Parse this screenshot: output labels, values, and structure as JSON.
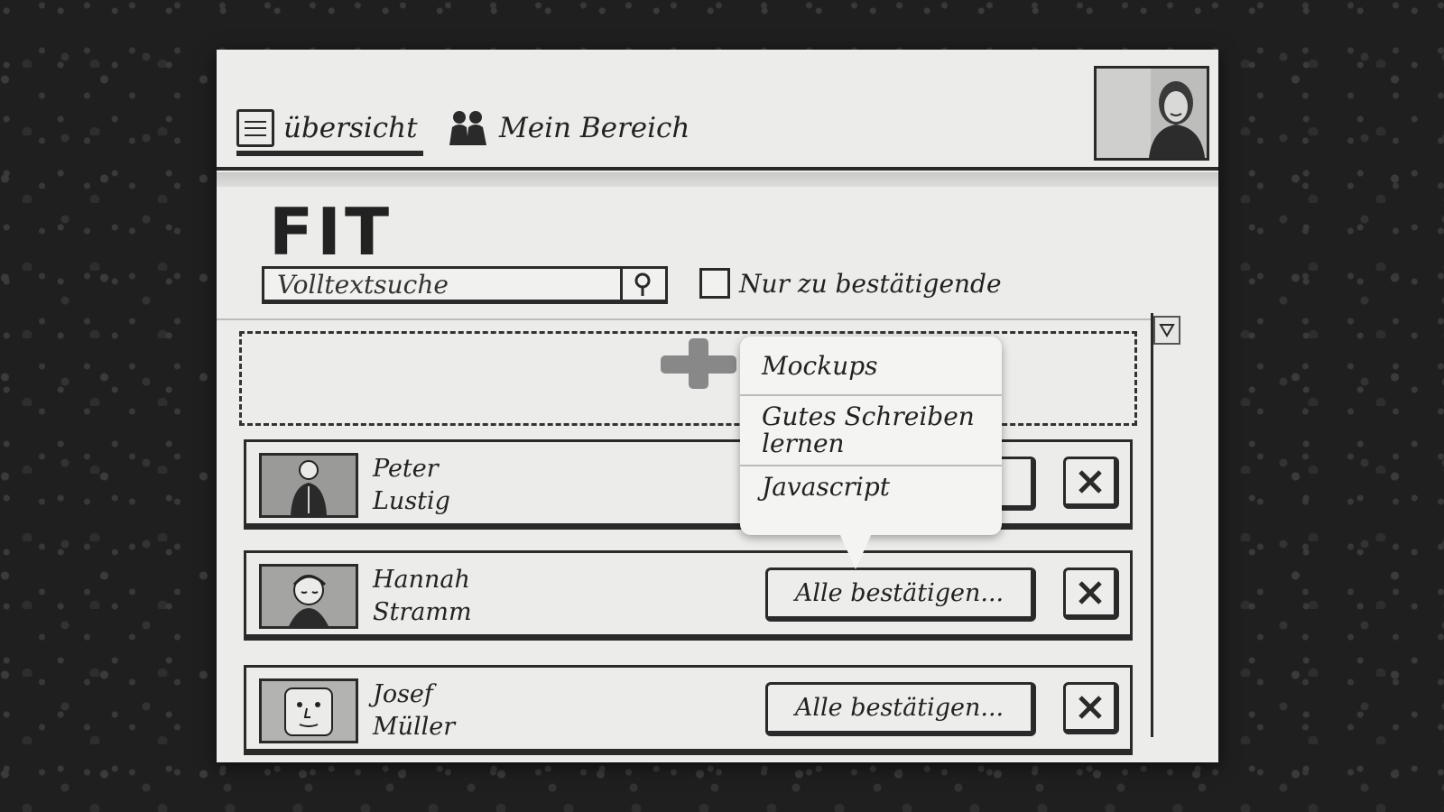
{
  "nav": {
    "tabs": [
      {
        "label": "übersicht",
        "icon": "list-icon",
        "active": true
      },
      {
        "label": "Mein Bereich",
        "icon": "people-icon",
        "active": false
      }
    ]
  },
  "main": {
    "title": "FIT",
    "search": {
      "placeholder": "Volltextsuche"
    },
    "filter": {
      "label": "Nur zu bestätigende",
      "checked": false
    }
  },
  "popup": {
    "items": [
      "Mockups",
      "Gutes Schreiben lernen",
      "Javascript"
    ]
  },
  "people": [
    {
      "first": "Peter",
      "last": "Lustig",
      "action_label": "...",
      "close": "✕"
    },
    {
      "first": "Hannah",
      "last": "Stramm",
      "action_label": "Alle bestätigen...",
      "close": "✕"
    },
    {
      "first": "Josef",
      "last": "Müller",
      "action_label": "Alle bestätigen...",
      "close": "✕"
    }
  ],
  "colors": {
    "ink": "#2a2a2a",
    "paper": "#ececea",
    "background": "#1f1f1f"
  }
}
